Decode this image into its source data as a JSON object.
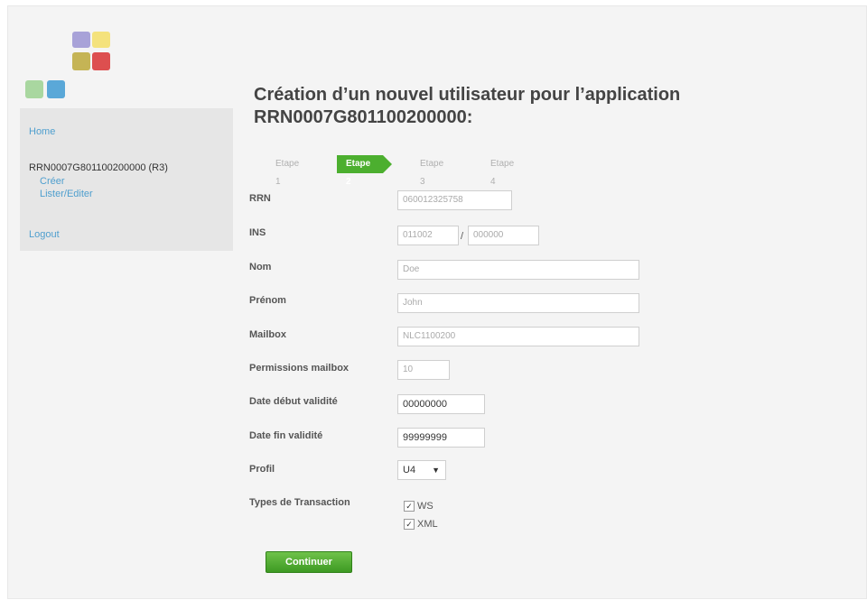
{
  "sidebar": {
    "home": "Home",
    "app_label": "RRN0007G801100200000 (R3)",
    "create": "Créer",
    "list_edit": "Lister/Editer",
    "logout": "Logout"
  },
  "title": "Création d’un nouvel utilisateur pour l’application RRN0007G801100200000:",
  "steps": [
    "Etape 1",
    "Etape 2",
    "Etape 3",
    "Etape 4"
  ],
  "form": {
    "rrn": {
      "label": "RRN",
      "value": "060012325758"
    },
    "ins": {
      "label": "INS",
      "value1": "011002",
      "separator": "/",
      "value2": "000000"
    },
    "nom": {
      "label": "Nom",
      "value": "Doe"
    },
    "prenom": {
      "label": "Prénom",
      "value": "John"
    },
    "mailbox": {
      "label": "Mailbox",
      "value": "NLC1100200"
    },
    "permissions": {
      "label": "Permissions mailbox",
      "value": "10"
    },
    "date_debut": {
      "label": "Date début validité",
      "value": "00000000"
    },
    "date_fin": {
      "label": "Date fin validité",
      "value": "99999999"
    },
    "profil": {
      "label": "Profil",
      "value": "U4"
    },
    "transactions": {
      "label": "Types de Transaction",
      "options": [
        "WS",
        "XML"
      ]
    }
  },
  "submit": "Continuer"
}
